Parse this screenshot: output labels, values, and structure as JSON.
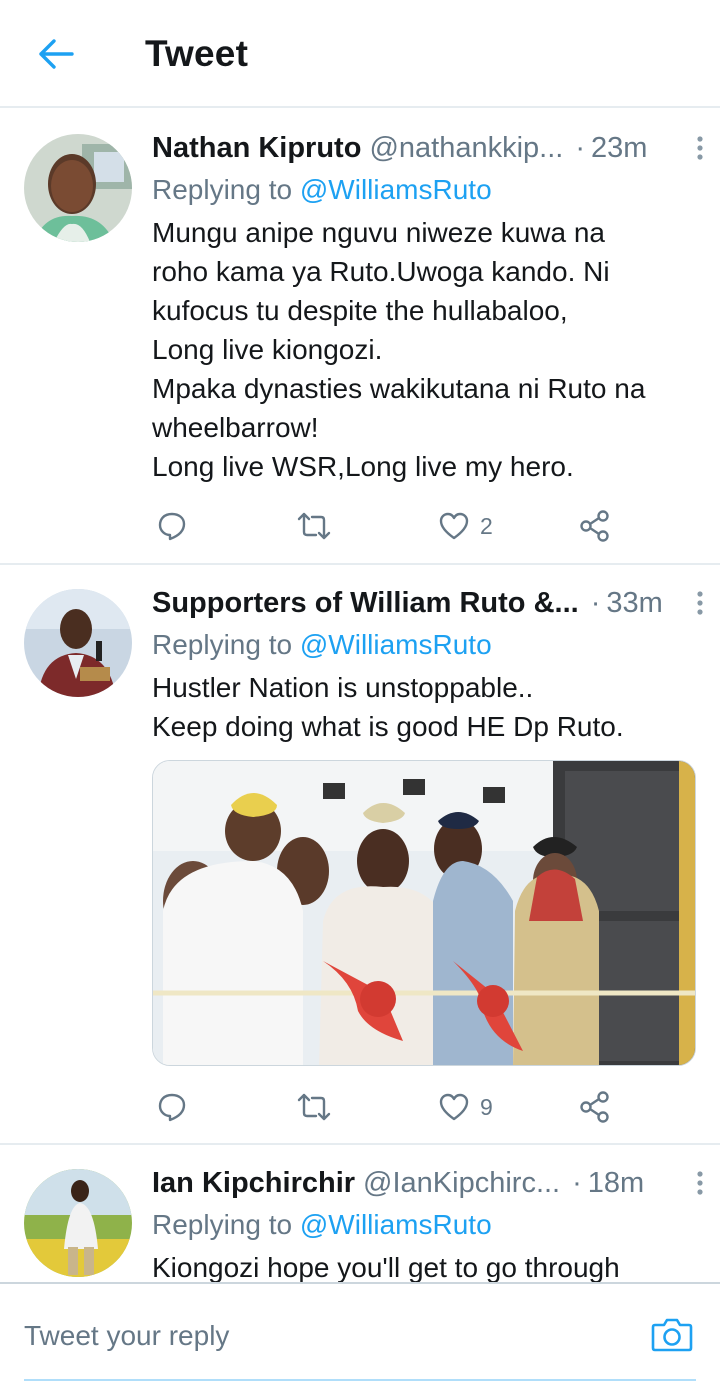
{
  "header": {
    "title": "Tweet",
    "back_icon": "arrow-left-icon",
    "accent_color": "#1da1f2"
  },
  "tweets": [
    {
      "name": "Nathan Kipruto",
      "handle": "@nathankkip...",
      "dot": "·",
      "time": "23m",
      "replying_prefix": "Replying to",
      "replying_handle": "@WilliamsRuto",
      "text": "Mungu anipe nguvu niweze kuwa na\nroho kama ya Ruto.Uwoga kando. Ni\nkufocus tu despite the hullabaloo,\nLong live kiongozi.\nMpaka dynasties wakikutana ni Ruto na\nwheelbarrow!\nLong live WSR,Long live my hero.",
      "replies": "",
      "retweets": "",
      "likes": "2"
    },
    {
      "name": "Supporters of William Ruto &...",
      "handle": "",
      "dot": "·",
      "time": "33m",
      "replying_prefix": "Replying to",
      "replying_handle": "@WilliamsRuto",
      "text": "Hustler Nation is unstoppable..\nKeep doing what is good HE Dp Ruto.",
      "replies": "",
      "retweets": "",
      "likes": "9"
    },
    {
      "name": "Ian Kipchirchir",
      "handle": "@IanKipchirc...",
      "dot": "·",
      "time": "18m",
      "replying_prefix": "Replying to",
      "replying_handle": "@WilliamsRuto",
      "text": "Kiongozi hope you'll get to go through"
    }
  ],
  "reply_bar": {
    "placeholder": "Tweet your reply",
    "camera_icon": "camera-icon"
  },
  "colors": {
    "text": "#14171a",
    "secondary": "#657786",
    "link": "#1da1f2",
    "divider": "#e6ecf0"
  }
}
